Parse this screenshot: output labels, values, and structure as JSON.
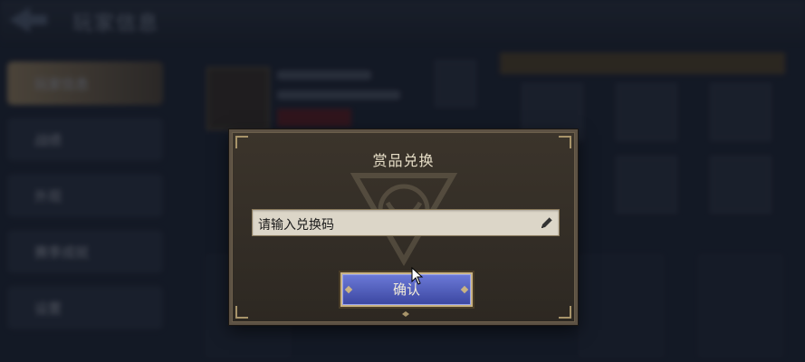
{
  "background": {
    "title": "玩家信息",
    "sidebar": [
      "玩家信息",
      "战绩",
      "外观",
      "赛季成就",
      "设置"
    ]
  },
  "modal": {
    "title": "赏品兑换",
    "input": {
      "value": "",
      "placeholder": "请输入兑换码"
    },
    "confirm_label": "确认"
  },
  "colors": {
    "modal_bg": "#342e27",
    "gold_border": "#c9b384",
    "button_blue": "#5360c2"
  },
  "icons": [
    "back-arrow-icon",
    "pencil-icon",
    "emblem-icon",
    "cursor-icon"
  ]
}
